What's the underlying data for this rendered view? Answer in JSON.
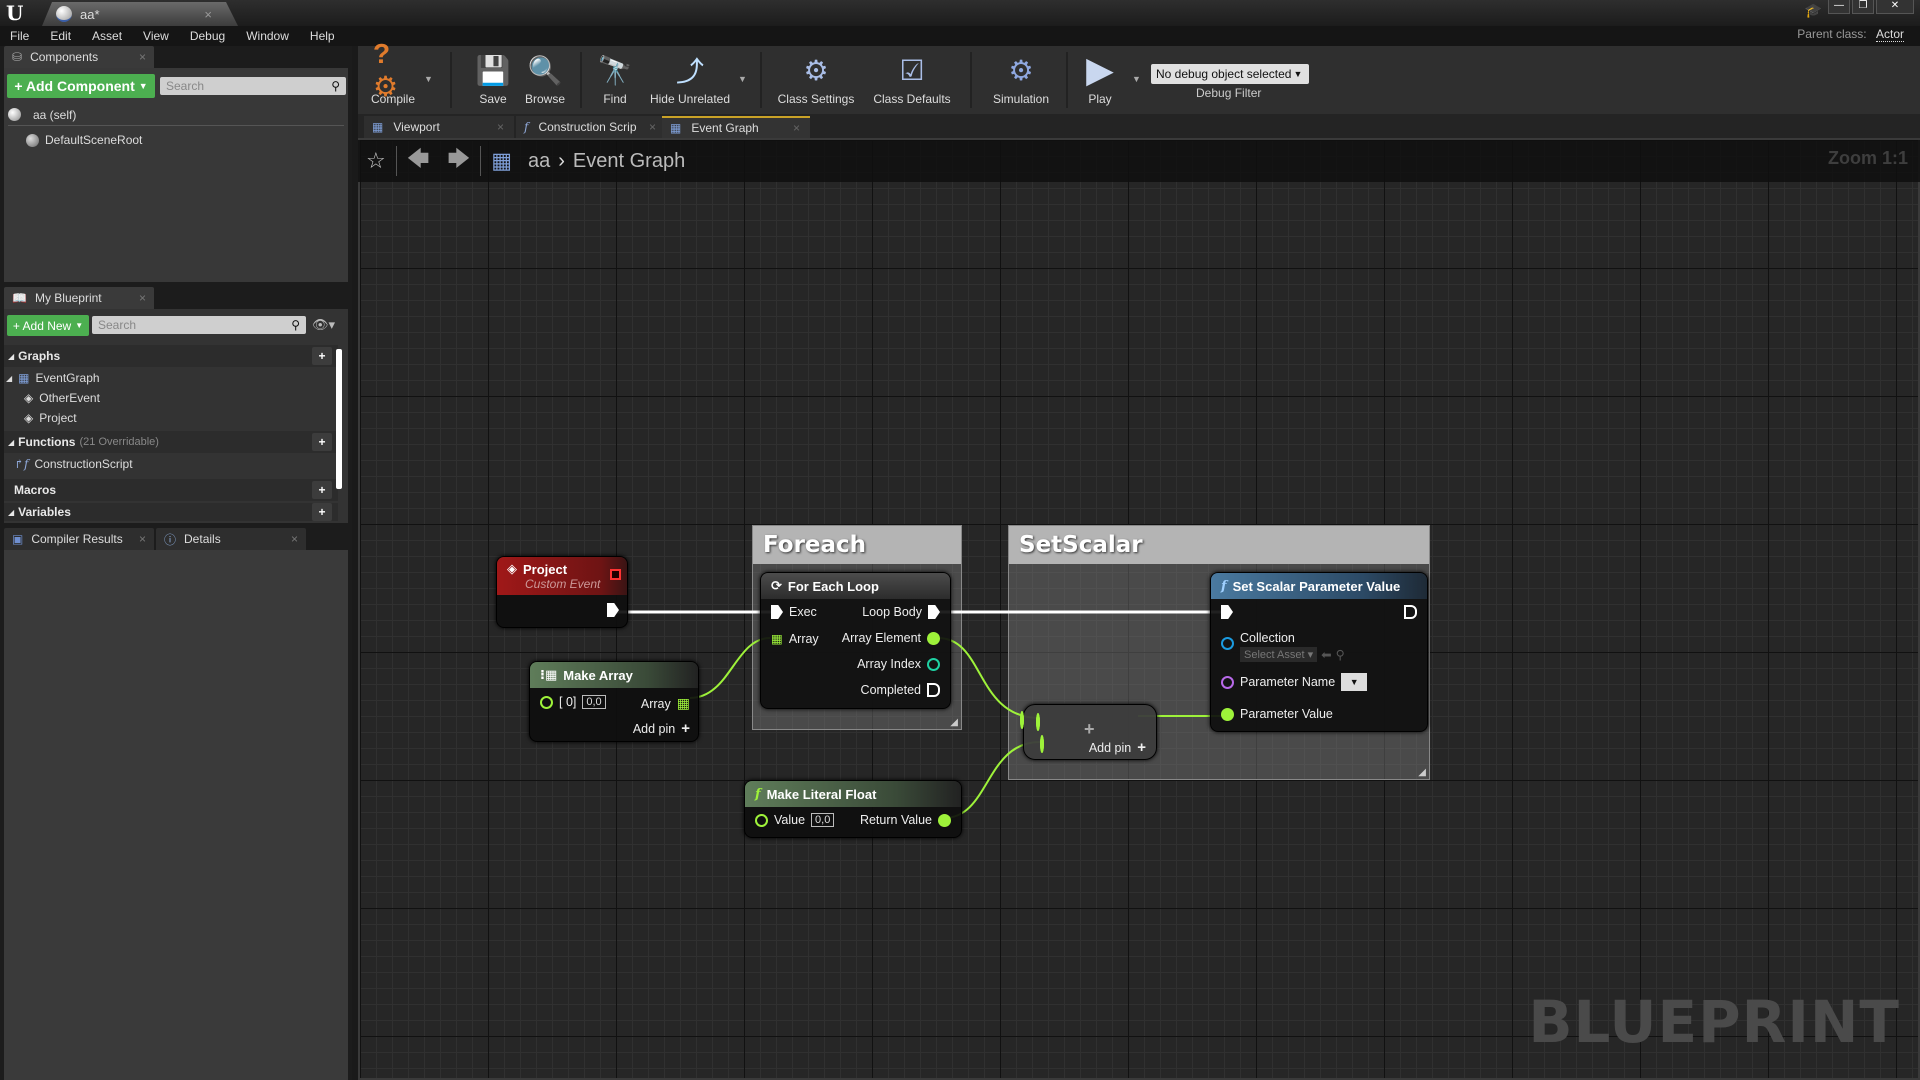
{
  "window": {
    "doc_tab": "aa*",
    "controls": {
      "minimize": "—",
      "restore": "❐",
      "close": "✕"
    }
  },
  "menu": [
    "File",
    "Edit",
    "Asset",
    "View",
    "Debug",
    "Window",
    "Help"
  ],
  "parent_class": {
    "label": "Parent class:",
    "value": "Actor"
  },
  "components": {
    "tab": "Components",
    "add_button": "+ Add Component",
    "search_placeholder": "Search",
    "items": [
      "aa (self)",
      "DefaultSceneRoot"
    ]
  },
  "my_blueprint": {
    "tab": "My Blueprint",
    "add_button": "+ Add New",
    "search_placeholder": "Search",
    "graphs_label": "Graphs",
    "graphs": [
      "EventGraph"
    ],
    "events": [
      "OtherEvent",
      "Project"
    ],
    "functions_label": "Functions",
    "functions_note": "(21 Overridable)",
    "functions": [
      "ConstructionScript"
    ],
    "macros_label": "Macros",
    "variables_label": "Variables"
  },
  "bottom_tabs": [
    "Compiler Results",
    "Details"
  ],
  "toolbar": {
    "buttons": [
      "Compile",
      "Save",
      "Browse",
      "Find",
      "Hide Unrelated",
      "Class Settings",
      "Class Defaults",
      "Simulation",
      "Play"
    ],
    "debug_select": "No debug object selected",
    "debug_label": "Debug Filter"
  },
  "graph_tabs": [
    "Viewport",
    "Construction Scrip",
    "Event Graph"
  ],
  "breadcrumb": {
    "root": "aa",
    "current": "Event Graph"
  },
  "zoom_label": "Zoom 1:1",
  "watermark": "BLUEPRINT",
  "comments": [
    "Foreach",
    "SetScalar"
  ],
  "nodes": {
    "project": {
      "title": "Project",
      "subtitle": "Custom Event"
    },
    "make_array": {
      "title": "Make Array",
      "pin_index": "[ 0]",
      "pin_value": "0,0",
      "out": "Array",
      "add_pin": "Add pin"
    },
    "for_each": {
      "title": "For Each Loop",
      "exec": "Exec",
      "array": "Array",
      "loop_body": "Loop Body",
      "element": "Array Element",
      "index": "Array Index",
      "completed": "Completed"
    },
    "set_scalar": {
      "title": "Set Scalar Parameter Value",
      "collection": "Collection",
      "select_asset": "Select Asset",
      "param_name": "Parameter Name",
      "param_value": "Parameter Value"
    },
    "add_node": {
      "add_pin": "Add pin"
    },
    "literal_float": {
      "title": "Make Literal Float",
      "value_label": "Value",
      "value": "0,0",
      "return": "Return Value"
    }
  },
  "colors": {
    "float_pin": "#9ef23a",
    "int_pin": "#1fd1a3",
    "object_pin": "#1b9be0",
    "name_pin": "#b769e8",
    "event_header": "#8a1515",
    "func_header": "#3c6f96",
    "pure_header": "#4b6b45"
  }
}
